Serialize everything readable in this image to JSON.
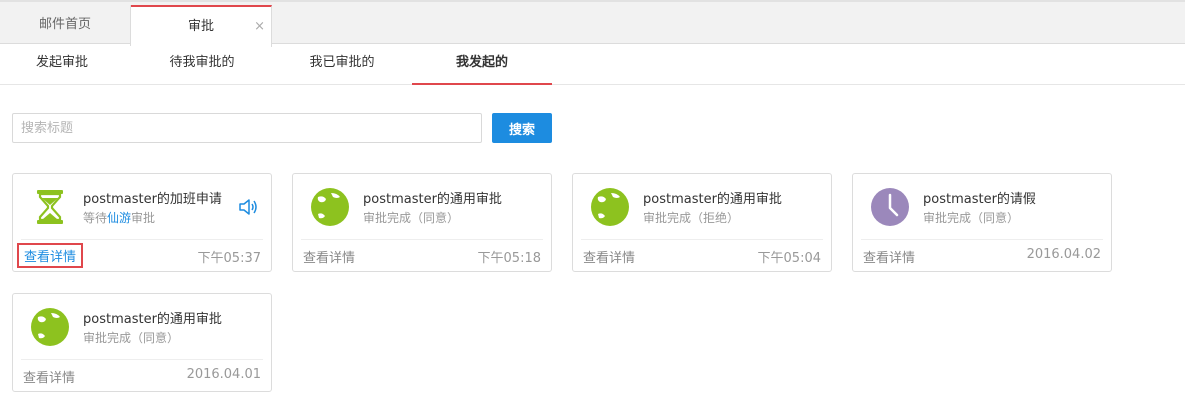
{
  "tabs": {
    "home_label": "邮件首页",
    "active_label": "审批",
    "close_glyph": "×"
  },
  "subnav": [
    {
      "label": "发起审批"
    },
    {
      "label": "待我审批的"
    },
    {
      "label": "我已审批的"
    },
    {
      "label": "我发起的",
      "active": true
    }
  ],
  "search": {
    "placeholder": "搜索标题",
    "button_label": "搜索"
  },
  "cards": [
    {
      "title": "postmaster的加班申请",
      "status_prefix": "等待",
      "status_highlight": "仙游",
      "status_suffix": "审批",
      "detail_label": "查看详情",
      "time": "下午05:37",
      "icon": "hourglass-icon",
      "speaker": "speaker-icon"
    },
    {
      "title": "postmaster的通用审批",
      "status": "审批完成（同意）",
      "detail_label": "查看详情",
      "time": "下午05:18",
      "icon": "globe-icon"
    },
    {
      "title": "postmaster的通用审批",
      "status": "审批完成（拒绝）",
      "detail_label": "查看详情",
      "time": "下午05:04",
      "icon": "globe-icon"
    },
    {
      "title": "postmaster的请假",
      "status": "审批完成（同意）",
      "detail_label": "查看详情",
      "time": "2016.04.02",
      "icon": "clock-icon"
    },
    {
      "title": "postmaster的通用审批",
      "status": "审批完成（同意）",
      "detail_label": "查看详情",
      "time": "2016.04.01",
      "icon": "globe-icon"
    }
  ],
  "colors": {
    "accent_red": "#e0474c",
    "primary_blue": "#1d8ce0",
    "globe_green": "#8dc21f",
    "clock_purple": "#9b88bb",
    "hourglass_green": "#8dc21f"
  }
}
